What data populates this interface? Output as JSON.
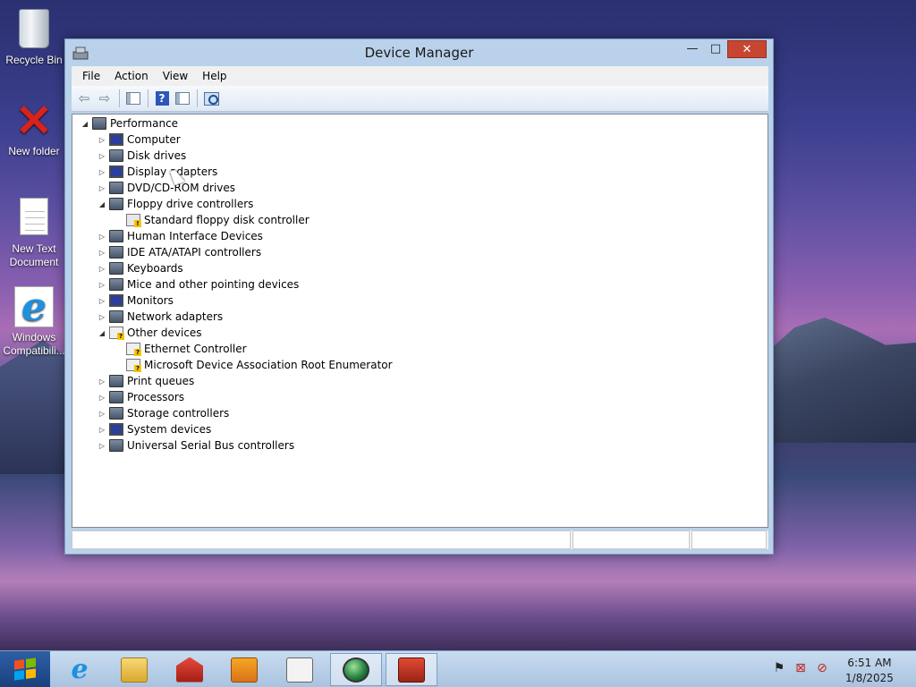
{
  "desktop": {
    "icons": [
      {
        "label": "Recycle Bin"
      },
      {
        "label": "New folder"
      },
      {
        "label": "New Text Document"
      },
      {
        "label": "Windows Compatibili..."
      }
    ]
  },
  "window": {
    "title": "Device Manager",
    "controls": {
      "minimize": "—",
      "maximize": "□",
      "close": "✕"
    },
    "menu": [
      "File",
      "Action",
      "View",
      "Help"
    ],
    "tree": {
      "root": "Performance",
      "items": [
        {
          "label": "Computer",
          "state": "collapsed",
          "icon": "computer-icon"
        },
        {
          "label": "Disk drives",
          "state": "collapsed",
          "icon": "disk-drive-icon"
        },
        {
          "label": "Display adapters",
          "state": "collapsed",
          "icon": "display-adapter-icon"
        },
        {
          "label": "DVD/CD-ROM drives",
          "state": "collapsed",
          "icon": "dvd-drive-icon"
        },
        {
          "label": "Floppy drive controllers",
          "state": "expanded",
          "icon": "floppy-controller-icon",
          "children": [
            {
              "label": "Standard floppy disk controller",
              "icon": "warning-device-icon"
            }
          ]
        },
        {
          "label": "Human Interface Devices",
          "state": "collapsed",
          "icon": "hid-icon"
        },
        {
          "label": "IDE ATA/ATAPI controllers",
          "state": "collapsed",
          "icon": "ide-controller-icon"
        },
        {
          "label": "Keyboards",
          "state": "collapsed",
          "icon": "keyboard-icon"
        },
        {
          "label": "Mice and other pointing devices",
          "state": "collapsed",
          "icon": "mouse-icon"
        },
        {
          "label": "Monitors",
          "state": "collapsed",
          "icon": "monitor-icon"
        },
        {
          "label": "Network adapters",
          "state": "collapsed",
          "icon": "network-adapter-icon"
        },
        {
          "label": "Other devices",
          "state": "expanded",
          "icon": "unknown-device-icon",
          "children": [
            {
              "label": "Ethernet Controller",
              "icon": "unknown-device-icon"
            },
            {
              "label": "Microsoft Device Association Root Enumerator",
              "icon": "unknown-device-icon"
            }
          ]
        },
        {
          "label": "Print queues",
          "state": "collapsed",
          "icon": "printer-icon"
        },
        {
          "label": "Processors",
          "state": "collapsed",
          "icon": "processor-icon"
        },
        {
          "label": "Storage controllers",
          "state": "collapsed",
          "icon": "storage-controller-icon"
        },
        {
          "label": "System devices",
          "state": "collapsed",
          "icon": "system-device-icon"
        },
        {
          "label": "Universal Serial Bus controllers",
          "state": "collapsed",
          "icon": "usb-icon"
        }
      ]
    }
  },
  "taskbar": {
    "clock": {
      "time": "6:51 AM",
      "date": "1/8/2025"
    }
  },
  "colors": {
    "close_button": "#c74632",
    "window_frame": "#b9d1ea",
    "taskbar": "#b5cde6"
  }
}
